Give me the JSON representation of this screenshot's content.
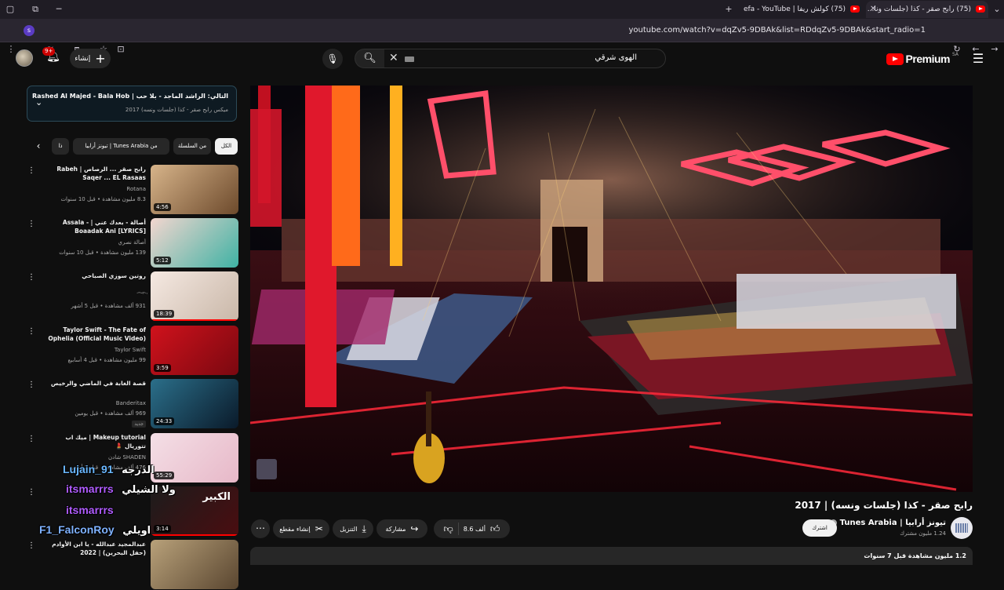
{
  "browser": {
    "tabs": [
      {
        "label": "(75) رابح صقر - كذا (جلسات ونا...",
        "active": true
      },
      {
        "label": "(75) كولش ريفا | Refa - YouTube",
        "active": false
      }
    ],
    "new_tab": "+",
    "url": "youtube.com/watch?v=dqZv5-9DBAk&list=RDdqZv5-9DBAk&start_radio=1",
    "profile_initial": "s"
  },
  "header": {
    "logo_text": "Premium",
    "logo_region": "SA",
    "search_query": "الهوى شرقي",
    "create_label": "إنشاء",
    "notifications_badge": "9+"
  },
  "playlist_card": {
    "next_label": "التالي: الراشد الماجد - بلا حب | Rashed Al Majed - Bala Hob",
    "sub_label": "ميكس رابح صقر - كذا (جلسات ونسه) 2017"
  },
  "chips": [
    "الكل",
    "من السلسلة",
    "من Tunes Arabia | تيونز أرابيا",
    "ذا"
  ],
  "recommendations": [
    {
      "title": "رابح صقر ... الرصاص | Rabeh Saqer ... EL Rasaas",
      "channel": "Rotana",
      "views": "8.3 مليون مشاهدة • قبل 10 سنوات",
      "duration": "4:56",
      "tag": ""
    },
    {
      "title": "أصالة - بعدك عني | Assala - Boaadak Ani [LYRICS]",
      "channel": "أصالة نصري",
      "views": "139 مليون مشاهدة • قبل 10 سنوات",
      "duration": "5:12",
      "tag": ""
    },
    {
      "title": "روتين سوزي الصباحي",
      "channel": "ٰ⁀ٰ⁀",
      "views": "931 ألف مشاهدة • قبل 5 أشهر",
      "duration": "18:39",
      "tag": ""
    },
    {
      "title": "Taylor Swift - The Fate of Ophelia (Official Music Video)",
      "channel": "Taylor Swift",
      "views": "99 مليون مشاهدة • قبل 4 أسابيع",
      "duration": "3:59",
      "tag": ""
    },
    {
      "title": "قصة الغابة في الماضي والرخيص",
      "channel": "Banderitax",
      "views": "969 ألف مشاهدة • قبل يومين",
      "duration": "24:33",
      "tag": "جديد"
    },
    {
      "title": "Makeup tutorial | ميك اب تتوريال 💄",
      "channel": "SHADEN شادن",
      "views": "476 ألف مشاهدة • قبل 3 أشهر",
      "duration": "55:29",
      "tag": ""
    },
    {
      "title": "الكبير",
      "channel": "",
      "views": "",
      "duration": "3:14",
      "tag": ""
    },
    {
      "title": "عبدالمجيد عبدالله - يا ابن الأوادم (حفل البحرين) | 2022",
      "channel": "",
      "views": "",
      "duration": "",
      "tag": ""
    }
  ],
  "chat_overlay": [
    {
      "user": "Lujain_91",
      "msg": "الدرجه",
      "color": "#6ab7ff"
    },
    {
      "user": "itsmarrrs",
      "msg": "ولا الشيلي",
      "color": "#b05cff"
    },
    {
      "user": "itsmarrrs",
      "msg": "",
      "color": "#b05cff"
    },
    {
      "user": "F1_FalconRoy",
      "msg": "اويلي",
      "color": "#7fb2ff"
    }
  ],
  "video": {
    "title": "رابح صقر - كذا (جلسات ونسه) | 2017",
    "channel": "تيونز أرابيا | Tunes Arabia",
    "subscribers": "1.24 مليون مشترك",
    "subscribe_label": "اشترك",
    "likes": "8.6 ألف",
    "share_label": "مشاركة",
    "download_label": "التنزيل",
    "clip_label": "إنشاء مقطع",
    "description_meta": "1.2 مليون مشاهدة  قبل 7 سنوات"
  },
  "colors": {
    "background": "#0f0f0f",
    "accent_red": "#ff0000",
    "chip_active": "#f1f1f1"
  }
}
